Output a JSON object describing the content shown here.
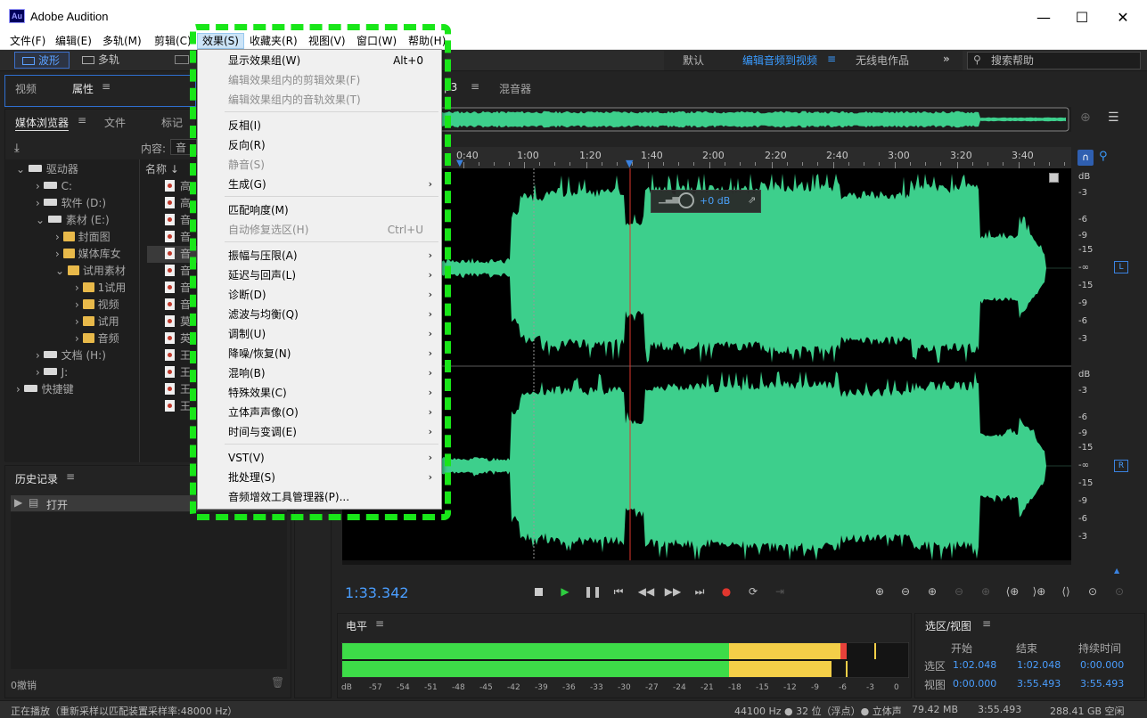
{
  "window": {
    "logo": "Au",
    "title": "Adobe Audition",
    "controls": [
      "—",
      "☐",
      "✕"
    ]
  },
  "menubar": [
    "文件(F)",
    "编辑(E)",
    "多轨(M)",
    "剪辑(C)",
    "效果(S)",
    "收藏夹(R)",
    "视图(V)",
    "窗口(W)",
    "帮助(H)"
  ],
  "toolbar": {
    "waveform": "波形",
    "multitrack": "多轨",
    "workspaces": [
      "默认",
      "编辑音频到视频",
      "无线电作品"
    ],
    "search_placeholder": "搜索帮助"
  },
  "left_top_tabs": [
    "视频",
    "属性"
  ],
  "media_tabs": [
    "媒体浏览器",
    "文件",
    "标记"
  ],
  "content_label": "内容:",
  "content_value": "音",
  "name_header": "名称",
  "tree": {
    "drives_root": "驱动器",
    "items": [
      "C:",
      "软件 (D:)",
      "素材 (E:)",
      "封面图",
      "媒体库女",
      "试用素材",
      "1试用",
      "视频",
      "试用",
      "音频",
      "文档 (H:)",
      "J:",
      "快捷键"
    ]
  },
  "files": [
    "高",
    "高",
    "音",
    "音",
    "音",
    "音",
    "音",
    "音",
    "莫",
    "英",
    "王",
    "王",
    "王",
    "王"
  ],
  "history": {
    "tab": "历史记录",
    "item": "打开",
    "undo_count": "0撤销"
  },
  "editor": {
    "tabs": [
      "p3",
      "混音器"
    ],
    "ruler": [
      "0:40",
      "1:00",
      "1:20",
      "1:40",
      "2:00",
      "2:20",
      "2:40",
      "3:00",
      "3:20",
      "3:40"
    ],
    "hud_gain": "+0 dB",
    "db_unit": "dB",
    "db_scale": [
      "-3",
      "-6",
      "-9",
      "-15",
      "-∞",
      "-15",
      "-9",
      "-6",
      "-3"
    ],
    "channels": [
      "L",
      "R"
    ],
    "time_readout": "1:33.342"
  },
  "level_meter": {
    "title": "电平",
    "scale": [
      "dB",
      "-57",
      "-54",
      "-51",
      "-48",
      "-45",
      "-42",
      "-39",
      "-36",
      "-33",
      "-30",
      "-27",
      "-24",
      "-21",
      "-18",
      "-15",
      "-12",
      "-9",
      "-6",
      "-3",
      "0"
    ],
    "colors": {
      "green": "#3ddc48",
      "yellow": "#f4cf48",
      "red": "#e8413a"
    }
  },
  "selection_view": {
    "title": "选区/视图",
    "headers": [
      "开始",
      "结束",
      "持续时间"
    ],
    "rows": [
      {
        "label": "选区",
        "start": "1:02.048",
        "end": "1:02.048",
        "duration": "0:00.000"
      },
      {
        "label": "视图",
        "start": "0:00.000",
        "end": "3:55.493",
        "duration": "3:55.493"
      }
    ]
  },
  "statusbar": {
    "left": "正在播放（重新采样以匹配装置采样率:48000 Hz）",
    "format": "44100 Hz ● 32 位（浮点）● 立体声",
    "size": "79.42 MB",
    "duration": "3:55.493",
    "free": "288.41 GB 空闲"
  },
  "effects_menu": {
    "items": [
      {
        "label": "显示效果组(W)",
        "shortcut": "Alt+0",
        "disabled": false,
        "submenu": false
      },
      {
        "label": "编辑效果组内的剪辑效果(F)",
        "shortcut": "",
        "disabled": true,
        "submenu": false
      },
      {
        "label": "编辑效果组内的音轨效果(T)",
        "shortcut": "",
        "disabled": true,
        "submenu": false
      },
      {
        "label": "反相(I)",
        "shortcut": "",
        "disabled": false,
        "submenu": false
      },
      {
        "label": "反向(R)",
        "shortcut": "",
        "disabled": false,
        "submenu": false
      },
      {
        "label": "静音(S)",
        "shortcut": "",
        "disabled": true,
        "submenu": false
      },
      {
        "label": "生成(G)",
        "shortcut": "",
        "disabled": false,
        "submenu": true
      },
      {
        "label": "匹配响度(M)",
        "shortcut": "",
        "disabled": false,
        "submenu": false
      },
      {
        "label": "自动修复选区(H)",
        "shortcut": "Ctrl+U",
        "disabled": true,
        "submenu": false
      },
      {
        "label": "振幅与压限(A)",
        "shortcut": "",
        "disabled": false,
        "submenu": true
      },
      {
        "label": "延迟与回声(L)",
        "shortcut": "",
        "disabled": false,
        "submenu": true
      },
      {
        "label": "诊断(D)",
        "shortcut": "",
        "disabled": false,
        "submenu": true
      },
      {
        "label": "滤波与均衡(Q)",
        "shortcut": "",
        "disabled": false,
        "submenu": true
      },
      {
        "label": "调制(U)",
        "shortcut": "",
        "disabled": false,
        "submenu": true
      },
      {
        "label": "降噪/恢复(N)",
        "shortcut": "",
        "disabled": false,
        "submenu": true
      },
      {
        "label": "混响(B)",
        "shortcut": "",
        "disabled": false,
        "submenu": true
      },
      {
        "label": "特殊效果(C)",
        "shortcut": "",
        "disabled": false,
        "submenu": true
      },
      {
        "label": "立体声声像(O)",
        "shortcut": "",
        "disabled": false,
        "submenu": true
      },
      {
        "label": "时间与变调(E)",
        "shortcut": "",
        "disabled": false,
        "submenu": true
      },
      {
        "label": "VST(V)",
        "shortcut": "",
        "disabled": false,
        "submenu": true
      },
      {
        "label": "批处理(S)",
        "shortcut": "",
        "disabled": false,
        "submenu": true
      },
      {
        "label": "音频增效工具管理器(P)...",
        "shortcut": "",
        "disabled": false,
        "submenu": false
      }
    ]
  }
}
